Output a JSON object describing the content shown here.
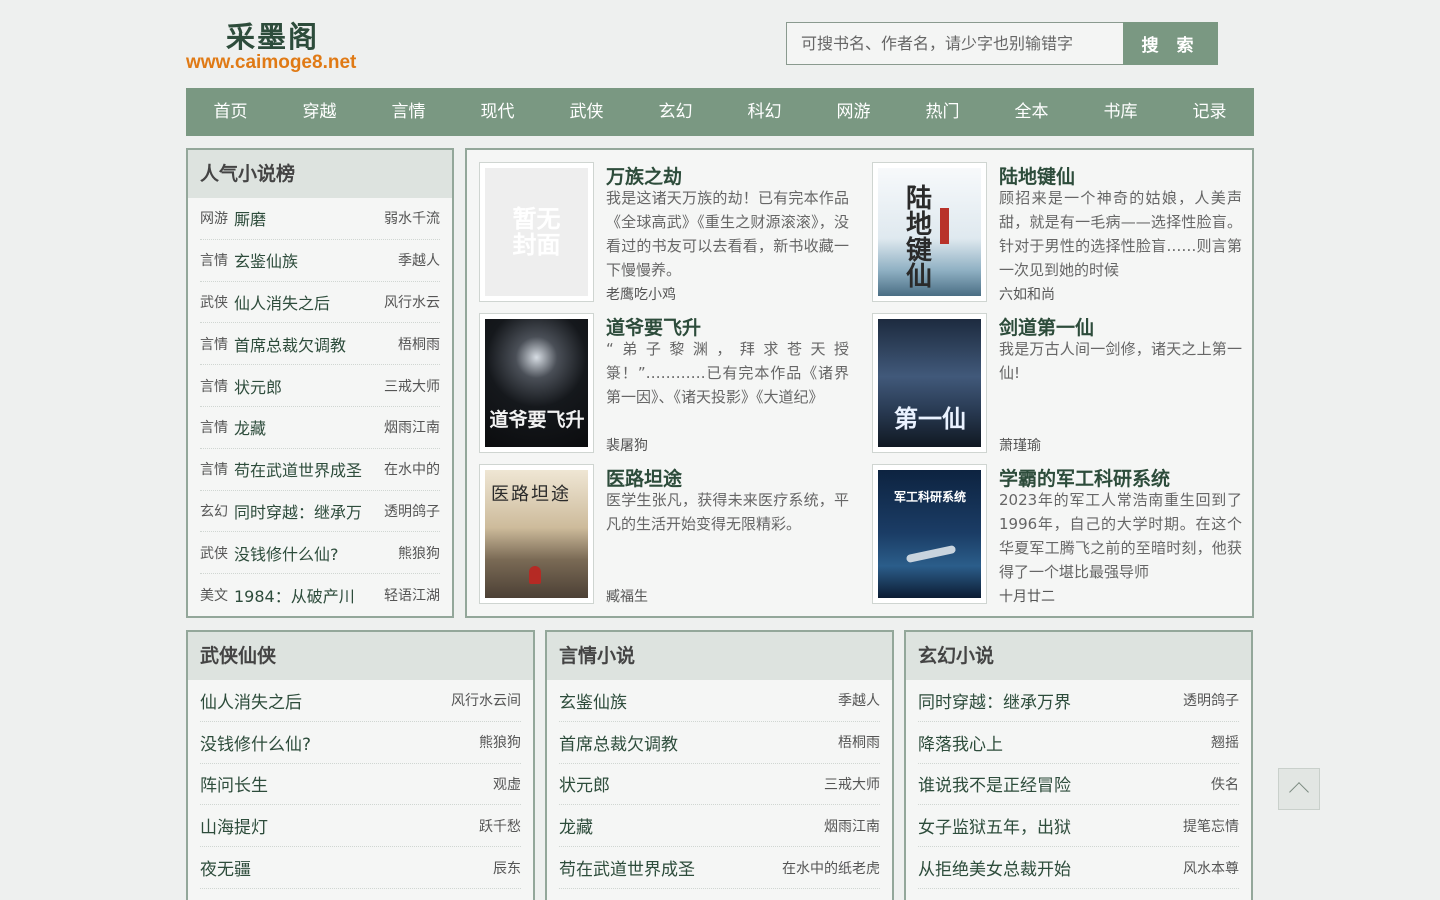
{
  "site": {
    "name": "采墨阁",
    "url": "www.caimoge8.net"
  },
  "search": {
    "placeholder": "可搜书名、作者名，请少字也别输错字",
    "button": "搜 索"
  },
  "nav": [
    "首页",
    "穿越",
    "言情",
    "现代",
    "武侠",
    "玄幻",
    "科幻",
    "网游",
    "热门",
    "全本",
    "书库",
    "记录"
  ],
  "ranking": {
    "title": "人气小说榜",
    "items": [
      {
        "cat": "网游",
        "title": "厮磨",
        "author": "弱水千流"
      },
      {
        "cat": "言情",
        "title": "玄鉴仙族",
        "author": "季越人"
      },
      {
        "cat": "武侠",
        "title": "仙人消失之后",
        "author": "风行水云"
      },
      {
        "cat": "言情",
        "title": "首席总裁欠调教",
        "author": "梧桐雨"
      },
      {
        "cat": "言情",
        "title": "状元郎",
        "author": "三戒大师"
      },
      {
        "cat": "言情",
        "title": "龙藏",
        "author": "烟雨江南"
      },
      {
        "cat": "言情",
        "title": "苟在武道世界成圣",
        "author": "在水中的"
      },
      {
        "cat": "玄幻",
        "title": "同时穿越：继承万",
        "author": "透明鸽子"
      },
      {
        "cat": "武侠",
        "title": "没钱修什么仙?",
        "author": "熊狼狗"
      },
      {
        "cat": "美文",
        "title": "1984：从破产川",
        "author": "轻语江湖"
      }
    ]
  },
  "featured": [
    {
      "title": "万族之劫",
      "desc": "我是这诸天万族的劫！已有完本作品《全球高武》《重生之财源滚滚》，没看过的书友可以去看看，新书收藏一下慢慢养。",
      "author": "老鹰吃小鸡",
      "cover_text": "暂无封面"
    },
    {
      "title": "陆地键仙",
      "desc": "顾招来是一个神奇的姑娘，人美声甜，就是有一毛病——选择性脸盲。针对于男性的选择性脸盲……则言第一次见到她的时候",
      "author": "六如和尚",
      "cover_text": "陆地键仙"
    },
    {
      "title": "道爷要飞升",
      "desc": "“弟子黎渊，拜求苍天授箓！”…………已有完本作品《诸界第一因》、《诸天投影》《大道纪》",
      "author": "裴屠狗",
      "cover_text": "道爷要飞升"
    },
    {
      "title": "剑道第一仙",
      "desc": "我是万古人间一剑修，诸天之上第一仙!",
      "author": "萧瑾瑜",
      "cover_text": "第一仙"
    },
    {
      "title": "医路坦途",
      "desc": "医学生张凡，获得未来医疗系统，平凡的生活开始变得无限精彩。",
      "author": "臧福生",
      "cover_text": "医路坦途"
    },
    {
      "title": "学霸的军工科研系统",
      "desc": "2023年的军工人常浩南重生回到了1996年，自己的大学时期。在这个华夏军工腾飞之前的至暗时刻，他获得了一个堪比最强导师",
      "author": "十月廿二",
      "cover_text": "军工科研系统"
    }
  ],
  "categories": [
    {
      "title": "武侠仙侠",
      "items": [
        {
          "title": "仙人消失之后",
          "author": "风行水云间"
        },
        {
          "title": "没钱修什么仙?",
          "author": "熊狼狗"
        },
        {
          "title": "阵问长生",
          "author": "观虚"
        },
        {
          "title": "山海提灯",
          "author": "跃千愁"
        },
        {
          "title": "夜无疆",
          "author": "辰东"
        }
      ]
    },
    {
      "title": "言情小说",
      "items": [
        {
          "title": "玄鉴仙族",
          "author": "季越人"
        },
        {
          "title": "首席总裁欠调教",
          "author": "梧桐雨"
        },
        {
          "title": "状元郎",
          "author": "三戒大师"
        },
        {
          "title": "龙藏",
          "author": "烟雨江南"
        },
        {
          "title": "苟在武道世界成圣",
          "author": "在水中的纸老虎"
        }
      ]
    },
    {
      "title": "玄幻小说",
      "items": [
        {
          "title": "同时穿越：继承万界",
          "author": "透明鸽子"
        },
        {
          "title": "降落我心上",
          "author": "翘摇"
        },
        {
          "title": "谁说我不是正经冒险",
          "author": "佚名"
        },
        {
          "title": "女子监狱五年，出狱",
          "author": "提笔忘情"
        },
        {
          "title": "从拒绝美女总裁开始",
          "author": "风水本尊"
        }
      ]
    }
  ]
}
